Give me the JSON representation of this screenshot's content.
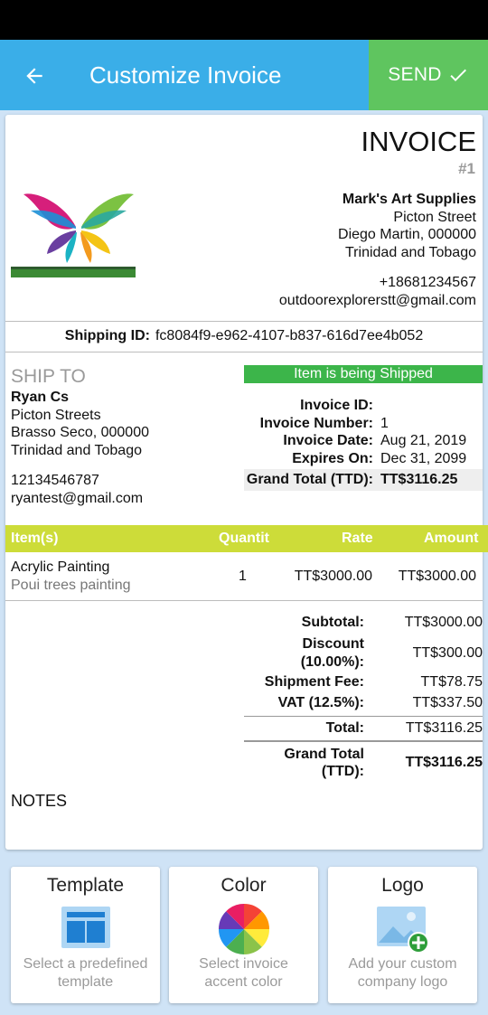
{
  "appbar": {
    "title": "Customize Invoice",
    "send_label": "SEND"
  },
  "invoice": {
    "title": "INVOICE",
    "number": "#1",
    "from": {
      "name": "Mark's Art Supplies",
      "street": "Picton Street",
      "city": "Diego Martin, 000000",
      "country": "Trinidad and Tobago",
      "phone": "+18681234567",
      "email": "outdoorexplorerstt@gmail.com"
    },
    "shipping": {
      "label": "Shipping ID:",
      "value": "fc8084f9-e962-4107-b837-616d7ee4b052"
    },
    "ship_to": {
      "label": "SHIP TO",
      "name": "Ryan Cs",
      "street": "Picton Streets",
      "city": "Brasso Seco, 000000",
      "country": "Trinidad and Tobago",
      "phone": "12134546787",
      "email": "ryantest@gmail.com"
    },
    "status": "Item is being Shipped",
    "meta": {
      "invoice_id_label": "Invoice ID:",
      "invoice_id_value": "",
      "invoice_number_label": "Invoice Number:",
      "invoice_number_value": "1",
      "invoice_date_label": "Invoice Date:",
      "invoice_date_value": "Aug 21, 2019",
      "expires_label": "Expires On:",
      "expires_value": "Dec 31, 2099",
      "grand_total_label": "Grand Total (TTD):",
      "grand_total_value": "TT$3116.25"
    },
    "items_header": {
      "item": "Item(s)",
      "quantity": "Quantit",
      "rate": "Rate",
      "amount": "Amount"
    },
    "items": [
      {
        "name": "Acrylic Painting",
        "description": "Poui trees painting",
        "quantity": "1",
        "rate": "TT$3000.00",
        "amount": "TT$3000.00"
      }
    ],
    "totals": {
      "subtotal_label": "Subtotal:",
      "subtotal_value": "TT$3000.00",
      "discount_label_1": "Discount",
      "discount_label_2": "(10.00%):",
      "discount_value": "TT$300.00",
      "shipment_label": "Shipment Fee:",
      "shipment_value": "TT$78.75",
      "vat_label": "VAT (12.5%):",
      "vat_value": "TT$337.50",
      "total_label": "Total:",
      "total_value": "TT$3116.25",
      "grand_label_1": "Grand Total",
      "grand_label_2": "(TTD):",
      "grand_value": "TT$3116.25"
    },
    "notes_label": "NOTES"
  },
  "bottom_cards": [
    {
      "title": "Template",
      "subtitle_1": "Select a predefined",
      "subtitle_2": "template",
      "icon": "template-icon"
    },
    {
      "title": "Color",
      "subtitle_1": "Select invoice",
      "subtitle_2": "accent color",
      "icon": "color-wheel-icon"
    },
    {
      "title": "Logo",
      "subtitle_1": "Add your custom",
      "subtitle_2": "company logo",
      "icon": "add-image-icon"
    }
  ],
  "colors": {
    "appbar": "#3aaee8",
    "send": "#5fc55f",
    "status": "#3cb54a",
    "items_header": "#cddc39"
  }
}
